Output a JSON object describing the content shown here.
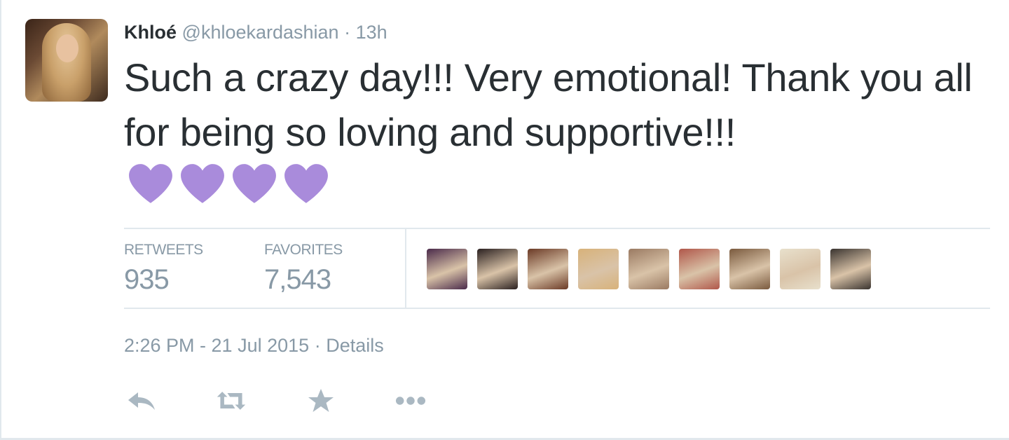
{
  "tweet": {
    "author_name": "Khloé",
    "author_handle": "@khloekardashian",
    "separator": "·",
    "relative_time": "13h",
    "text": "Such a crazy day!!! Very emotional! Thank you all for being so loving and supportive!!!",
    "emoji": [
      "purple-heart",
      "purple-heart",
      "purple-heart",
      "purple-heart"
    ],
    "emoji_color": "#a98bdb"
  },
  "stats": {
    "retweets_label": "RETWEETS",
    "retweets_value": "935",
    "favorites_label": "FAVORITES",
    "favorites_value": "7,543"
  },
  "favoriters": [
    {
      "name": "favoriter-avatar-1",
      "color": "#4a2a4a"
    },
    {
      "name": "favoriter-avatar-2",
      "color": "#2a2020"
    },
    {
      "name": "favoriter-avatar-3",
      "color": "#6b3a26"
    },
    {
      "name": "favoriter-avatar-4",
      "color": "#d8b27a"
    },
    {
      "name": "favoriter-avatar-5",
      "color": "#9a7a62"
    },
    {
      "name": "favoriter-avatar-6",
      "color": "#b0574a"
    },
    {
      "name": "favoriter-avatar-7",
      "color": "#7a5a3e"
    },
    {
      "name": "favoriter-avatar-8",
      "color": "#e8e0cc"
    },
    {
      "name": "favoriter-avatar-9",
      "color": "#3a3430"
    }
  ],
  "timestamp": {
    "time": "2:26 PM - 21 Jul 2015",
    "separator": "·",
    "details": "Details"
  },
  "actions": [
    "reply-icon",
    "retweet-icon",
    "favorite-star-icon",
    "more-dots-icon"
  ],
  "colors": {
    "text": "#292f33",
    "muted": "#8899a6",
    "border": "#e1e8ed",
    "icon": "#aab8c2"
  }
}
